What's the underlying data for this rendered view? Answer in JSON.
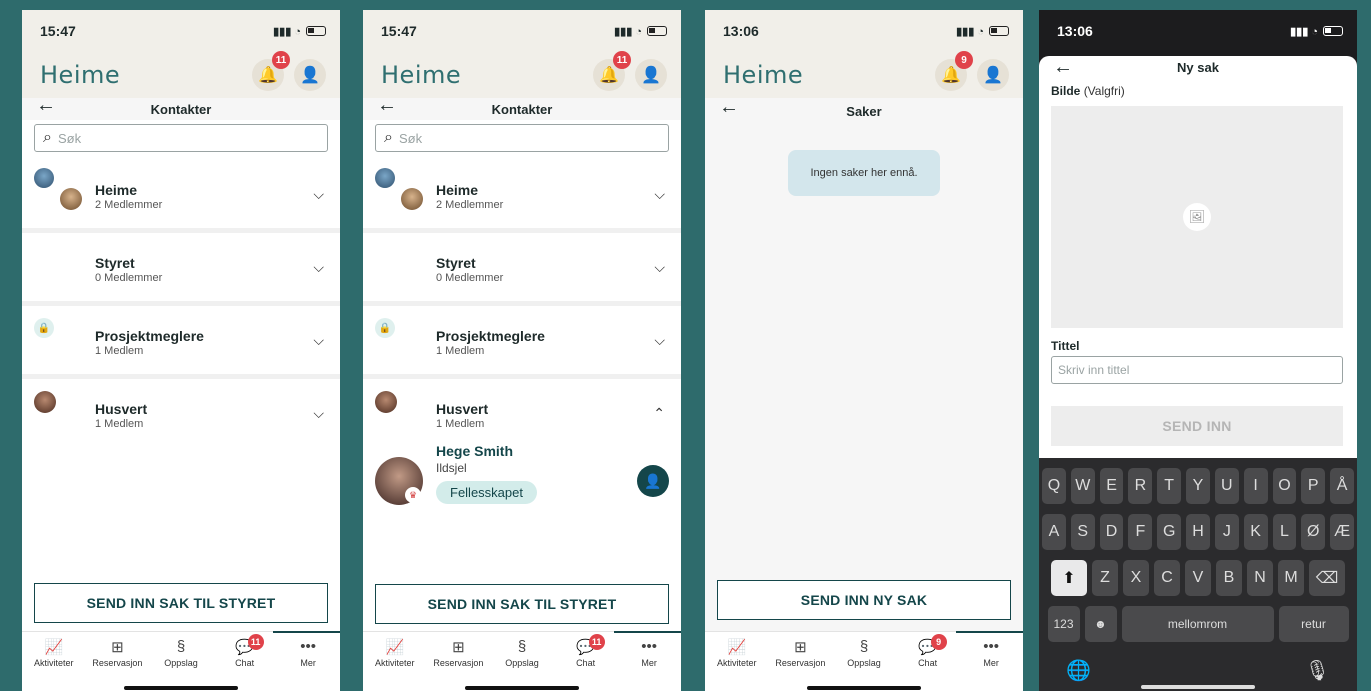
{
  "brand": {
    "logo": "Heime",
    "accent": "#14464a",
    "badge_color": "#e0424a",
    "background": "#2e6b6c"
  },
  "phones": [
    {
      "time": "15:47",
      "notif_count": "11",
      "screen_title": "Kontakter",
      "search_placeholder": "Søk",
      "groups": [
        {
          "name": "Heime",
          "sub": "2 Medlemmer"
        },
        {
          "name": "Styret",
          "sub": "0 Medlemmer"
        },
        {
          "name": "Prosjektmeglere",
          "sub": "1 Medlem"
        },
        {
          "name": "Husvert",
          "sub": "1 Medlem"
        }
      ],
      "button": "SEND INN SAK TIL STYRET",
      "chat_badge": "11"
    },
    {
      "time": "15:47",
      "notif_count": "11",
      "screen_title": "Kontakter",
      "search_placeholder": "Søk",
      "groups": [
        {
          "name": "Heime",
          "sub": "2 Medlemmer"
        },
        {
          "name": "Styret",
          "sub": "0 Medlemmer"
        },
        {
          "name": "Prosjektmeglere",
          "sub": "1 Medlem"
        },
        {
          "name": "Husvert",
          "sub": "1 Medlem"
        }
      ],
      "member": {
        "name": "Hege Smith",
        "role": "Ildsjel",
        "tag": "Fellesskapet"
      },
      "button": "SEND INN SAK TIL STYRET",
      "chat_badge": "11"
    },
    {
      "time": "13:06",
      "notif_count": "9",
      "screen_title": "Saker",
      "empty_message": "Ingen saker her ennå.",
      "button": "SEND INN NY SAK",
      "chat_badge": "9"
    },
    {
      "time": "13:06",
      "screen_title": "Ny sak",
      "image_label": "Bilde",
      "image_optional": "(Valgfri)",
      "title_label": "Tittel",
      "title_placeholder": "Skriv inn tittel",
      "submit": "SEND INN",
      "keyboard": {
        "row1": [
          "Q",
          "W",
          "E",
          "R",
          "T",
          "Y",
          "U",
          "I",
          "O",
          "P",
          "Å"
        ],
        "row2": [
          "A",
          "S",
          "D",
          "F",
          "G",
          "H",
          "J",
          "K",
          "L",
          "Ø",
          "Æ"
        ],
        "row3": [
          "Z",
          "X",
          "C",
          "V",
          "B",
          "N",
          "M"
        ],
        "num_key": "123",
        "space_key": "mellomrom",
        "return_key": "retur"
      }
    }
  ],
  "tabs": [
    "Aktiviteter",
    "Reservasjon",
    "Oppslag",
    "Chat",
    "Mer"
  ]
}
